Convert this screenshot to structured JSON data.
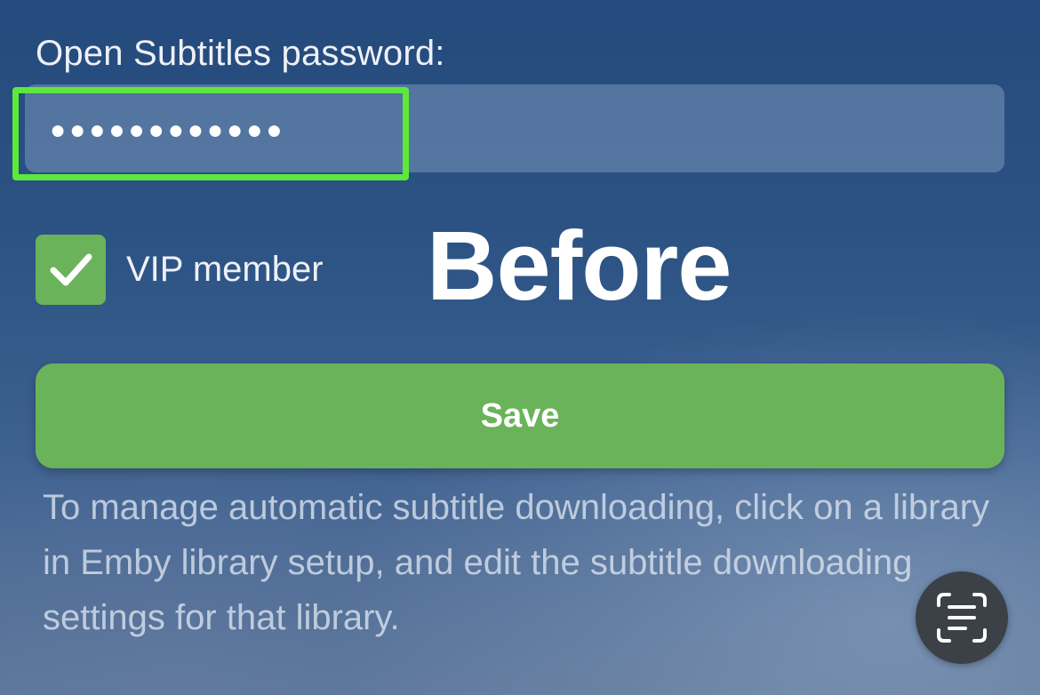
{
  "form": {
    "password_label": "Open Subtitles password:",
    "password_value": "●●●●●●●●●●●●",
    "vip_label": "VIP member",
    "vip_checked": true,
    "save_label": "Save",
    "help_text": "To manage automatic subtitle downloading, click on a library in Emby library setup, and edit the subtitle downloading settings for that library."
  },
  "overlay": {
    "caption": "Before",
    "highlight_color": "#5ee83c"
  },
  "colors": {
    "accent_green": "#6ab35a",
    "scan_button_bg": "#3b4147"
  },
  "icons": {
    "checkbox": "checkmark-icon",
    "scan": "live-text-scan-icon"
  }
}
